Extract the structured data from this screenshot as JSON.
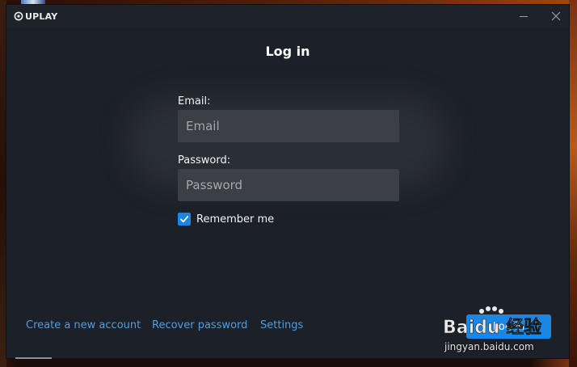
{
  "app": {
    "logo_text": "UPLAY"
  },
  "titlebar": {
    "minimize_icon": "minimize-icon",
    "close_icon": "close-icon"
  },
  "login": {
    "title": "Log in",
    "email_label": "Email:",
    "email_value": "",
    "email_placeholder": "Email",
    "password_label": "Password:",
    "password_value": "",
    "password_placeholder": "Password",
    "remember_label": "Remember me",
    "remember_checked": true,
    "login_button": "Log in"
  },
  "footer": {
    "links": [
      "Create a new account",
      "Recover password",
      "Settings"
    ]
  },
  "watermark": {
    "brand": "Baidu 经验",
    "url": "jingyan.baidu.com"
  },
  "colors": {
    "window_bg": "#1c2028",
    "input_bg": "#3c3f45",
    "accent": "#1a87e6",
    "link": "#4d9fe0"
  }
}
